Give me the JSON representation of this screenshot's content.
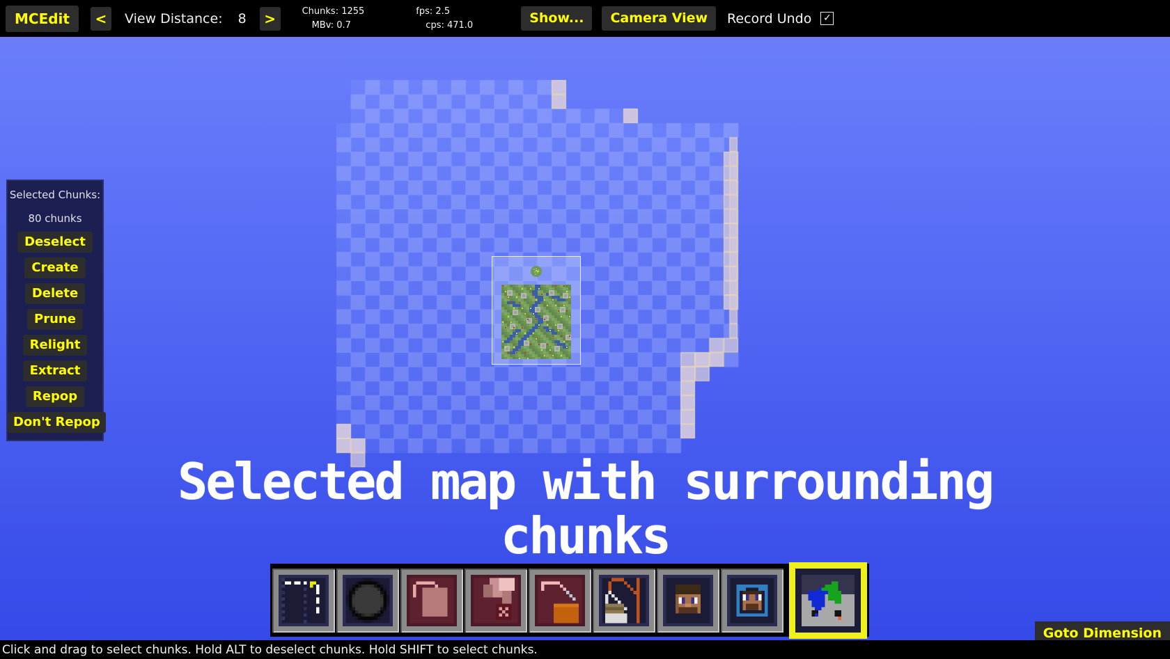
{
  "app": {
    "title": "MCEdit"
  },
  "toolbar": {
    "app_button": "MCEdit",
    "prev_button": "<",
    "next_button": ">",
    "view_distance_label": "View Distance:",
    "view_distance_value": "8",
    "stats": {
      "chunks": "Chunks: 1255",
      "mbv": "MBv: 0.7",
      "fps": "fps: 2.5",
      "cps": "cps: 471.0"
    },
    "show_button": "Show...",
    "camera_view_button": "Camera View",
    "record_undo_label": "Record Undo",
    "record_undo_checked": "✓",
    "accent_yellow": "#ffff00",
    "button_bg": "#2d2d2d"
  },
  "chunk_panel": {
    "title": "Selected Chunks:",
    "count": "80 chunks",
    "buttons": [
      {
        "name": "deselect",
        "label": "Deselect"
      },
      {
        "name": "create",
        "label": "Create"
      },
      {
        "name": "delete",
        "label": "Delete"
      },
      {
        "name": "prune",
        "label": "Prune"
      },
      {
        "name": "relight",
        "label": "Relight"
      },
      {
        "name": "extract",
        "label": "Extract"
      },
      {
        "name": "repop",
        "label": "Repop"
      }
    ],
    "dont_repop_label": "Don't Repop",
    "panel_bg": "#1c1f52"
  },
  "viewport": {
    "caption_line1": "Selected map with surrounding",
    "caption_line2": "chunks",
    "sky_top_color": "#6b7dfb",
    "sky_bottom_color": "#3449e7",
    "selection_highlight_color": "#d6cde2"
  },
  "hotbar": {
    "slots": [
      {
        "name": "selection-tool",
        "icon": "dashed-box-icon",
        "selected": false
      },
      {
        "name": "brush-tool",
        "icon": "black-circle-icon",
        "selected": false
      },
      {
        "name": "clone-tool",
        "icon": "clone-square-icon",
        "selected": false
      },
      {
        "name": "fill-tool",
        "icon": "fill-bucket-icon",
        "selected": false
      },
      {
        "name": "filter-tool",
        "icon": "cauldron-icon",
        "selected": false
      },
      {
        "name": "construction-tool",
        "icon": "crane-icon",
        "selected": false
      },
      {
        "name": "player-tool",
        "icon": "steve-head-icon",
        "selected": false
      },
      {
        "name": "spawn-tool",
        "icon": "spawner-head-icon",
        "selected": false
      },
      {
        "name": "chunk-tool",
        "icon": "chunk-map-icon",
        "selected": true
      }
    ],
    "selected_index": 8,
    "selection_border_color": "#efef1a"
  },
  "footer": {
    "goto_dimension_label": "Goto Dimension",
    "status_text": "Click and drag to select chunks. Hold ALT to deselect chunks. Hold SHIFT to select chunks."
  }
}
